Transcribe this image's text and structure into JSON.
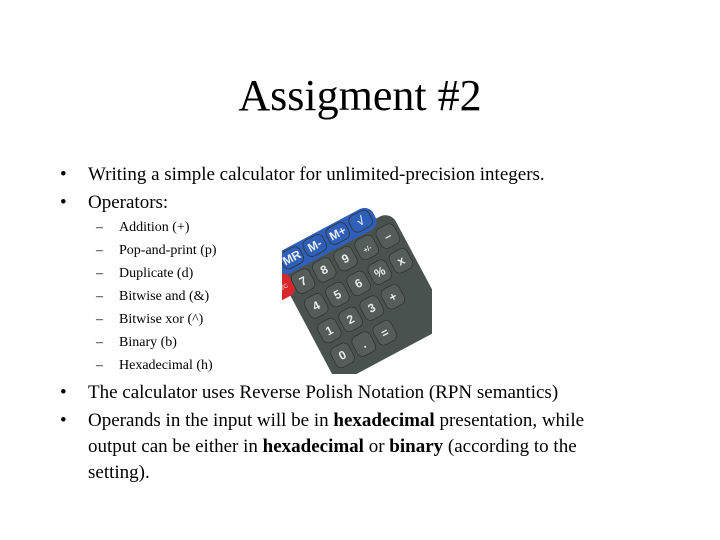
{
  "slide": {
    "title": "Assigment #2",
    "bullets_top": [
      {
        "marker": "•",
        "text": "Writing a simple calculator for unlimited-precision integers."
      },
      {
        "marker": "•",
        "text": "Operators:"
      }
    ],
    "operators": [
      {
        "marker": "–",
        "text": "Addition (+)"
      },
      {
        "marker": "–",
        "text": "Pop-and-print (p)"
      },
      {
        "marker": "–",
        "text": "Duplicate (d)"
      },
      {
        "marker": "–",
        "text": "Bitwise and (&)"
      },
      {
        "marker": "–",
        "text": "Bitwise xor (^)"
      },
      {
        "marker": "–",
        "text": "Binary (b)"
      },
      {
        "marker": "–",
        "text": "Hexadecimal (h)"
      }
    ],
    "bullets_bottom": [
      {
        "marker": "•",
        "text": "The calculator uses Reverse Polish Notation (RPN semantics)"
      },
      {
        "marker": "•",
        "line1_pre": "Operands in the input will be in ",
        "line1_bold": "hexadecimal",
        "line1_post": " presentation, while",
        "line2_pre": "output can be either in ",
        "line2_bold1": "hexadecimal",
        "line2_mid": " or ",
        "line2_bold2": "binary",
        "line2_post": " (according to the",
        "line3": "setting)."
      }
    ],
    "image": {
      "name": "calculator-keypad",
      "keys_blue": [
        "MR",
        "M-",
        "M+",
        "√"
      ],
      "key_red": "ON/C",
      "keys_gray": [
        "7",
        "8",
        "9",
        "+/-",
        "–",
        "4",
        "5",
        "6",
        "%",
        "x",
        "1",
        "2",
        "3",
        "+",
        "0",
        ".",
        "="
      ],
      "colors": {
        "keypad": "#4a5250",
        "blue": "#2f5fb8",
        "red": "#d8262a",
        "label": "#e8ecea"
      }
    }
  }
}
